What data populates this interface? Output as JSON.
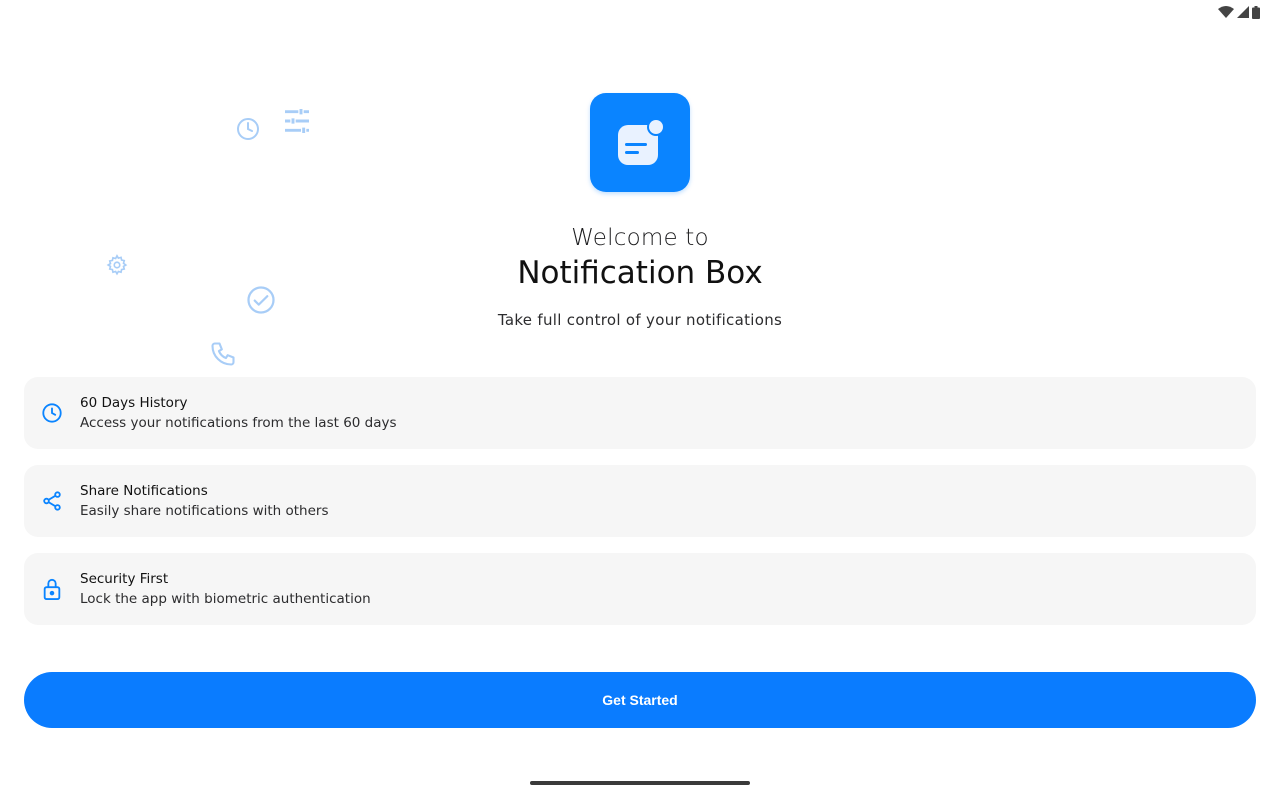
{
  "colors": {
    "accent": "#0a84ff",
    "deco": "#a8cdf7",
    "card_bg": "#f6f6f6"
  },
  "status_bar": {
    "icons": [
      "wifi-icon",
      "signal-icon",
      "battery-icon"
    ]
  },
  "decorative_icons": [
    "clock-icon",
    "tune-icon",
    "gear-icon",
    "check-circle-icon",
    "phone-icon",
    "star-icon",
    "shield-icon",
    "bell-icon"
  ],
  "hero": {
    "icon": "notification-box-logo",
    "welcome": "Welcome to",
    "app_name": "Notification Box",
    "tagline": "Take full control of your notifications"
  },
  "features": [
    {
      "icon": "history-clock-icon",
      "title": "60 Days History",
      "description": "Access your notifications from the last 60 days"
    },
    {
      "icon": "share-icon",
      "title": "Share Notifications",
      "description": "Easily share notifications with others"
    },
    {
      "icon": "lock-icon",
      "title": "Security First",
      "description": "Lock the app with biometric authentication"
    }
  ],
  "cta": {
    "label": "Get Started"
  }
}
